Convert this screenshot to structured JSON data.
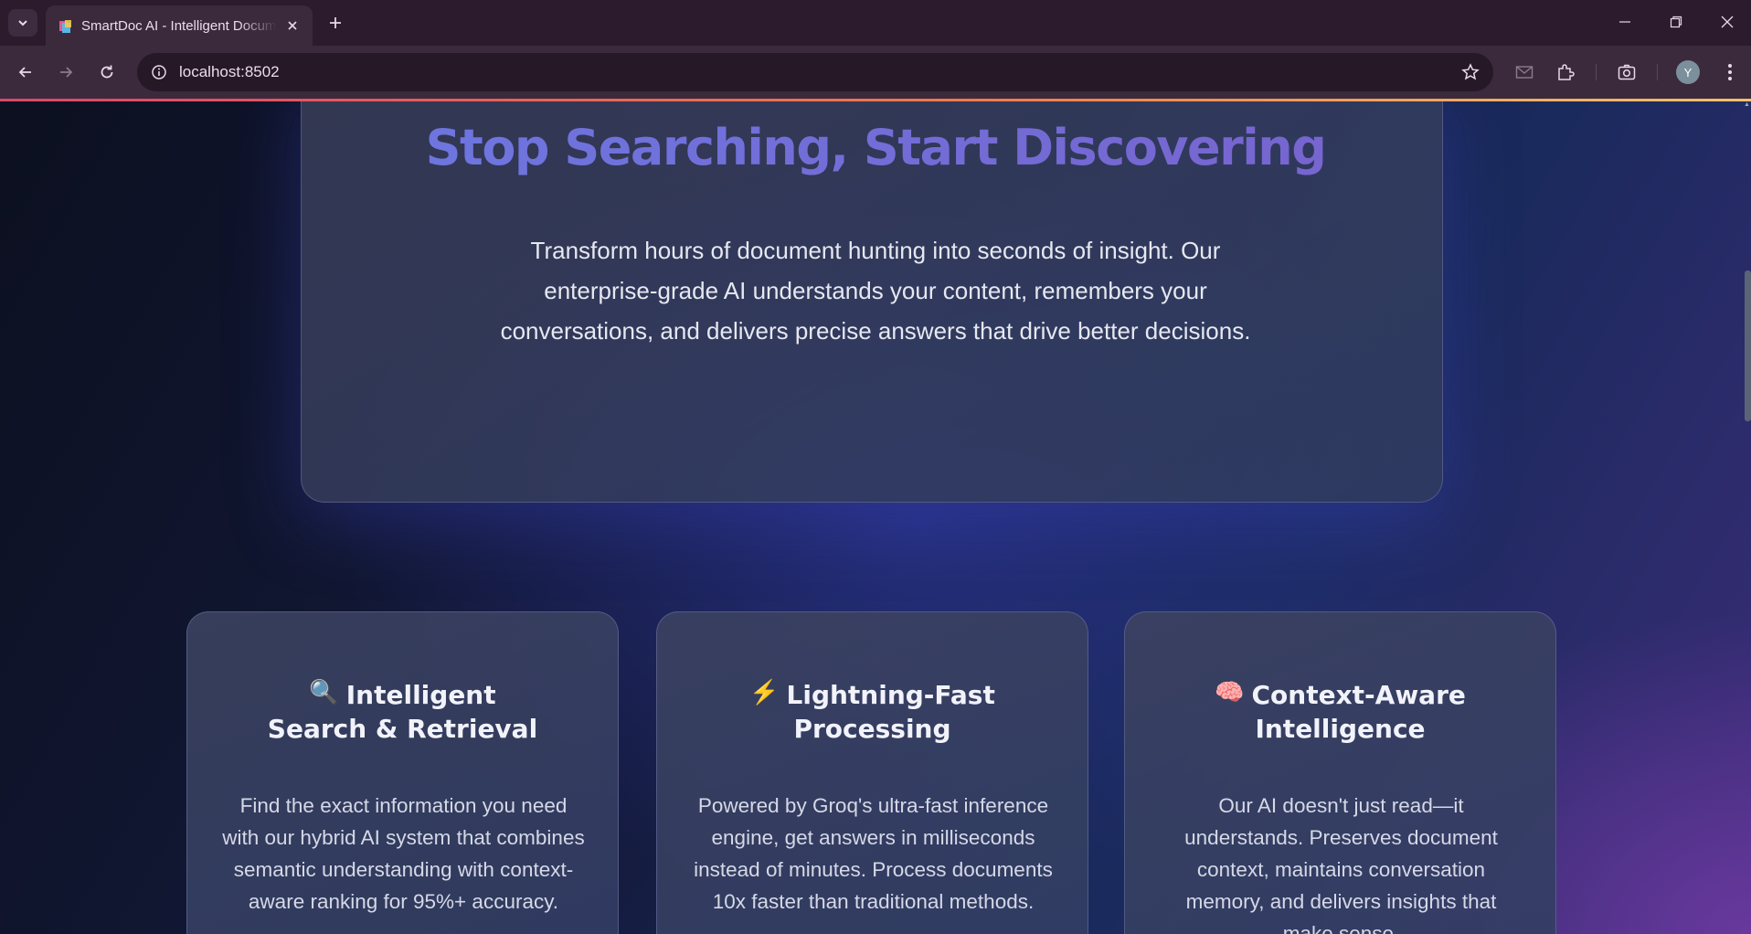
{
  "browser": {
    "tab_title": "SmartDoc AI - Intelligent Document Assistant",
    "url": "localhost:8502",
    "avatar_letter": "Y"
  },
  "hero": {
    "title": "Stop Searching, Start Discovering",
    "subtitle": "Transform hours of document hunting into seconds of insight. Our enterprise-grade AI understands your content, remembers your conversations, and delivers precise answers that drive better decisions."
  },
  "features": [
    {
      "icon": "🔍",
      "icon_name": "magnifier-icon",
      "title": "Intelligent Search & Retrieval",
      "description": "Find the exact information you need with our hybrid AI system that combines semantic understanding with context-aware ranking for 95%+ accuracy."
    },
    {
      "icon": "⚡",
      "icon_name": "lightning-icon",
      "title": "Lightning-Fast Processing",
      "description": "Powered by Groq's ultra-fast inference engine, get answers in milliseconds instead of minutes. Process documents 10x faster than traditional methods."
    },
    {
      "icon": "🧠",
      "icon_name": "brain-icon",
      "title": "Context-Aware Intelligence",
      "description": "Our AI doesn't just read—it understands. Preserves document context, maintains conversation memory, and delivers insights that make sense."
    }
  ]
}
